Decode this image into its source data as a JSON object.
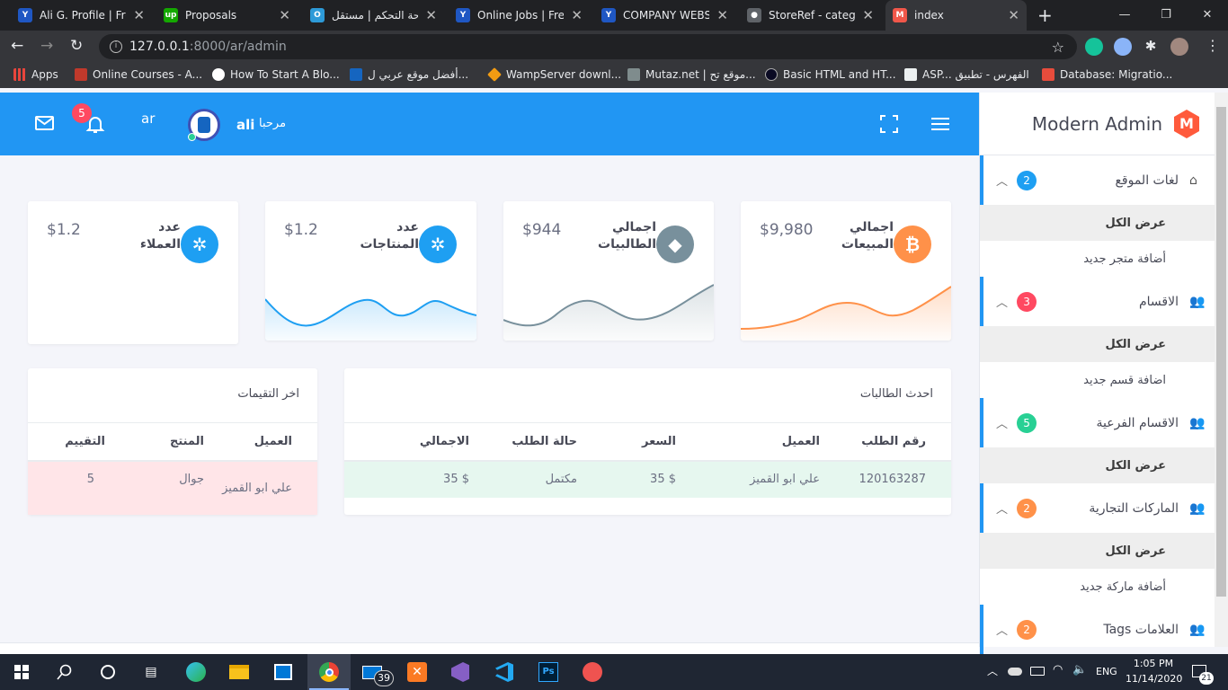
{
  "browser": {
    "tabs": [
      {
        "title": "Ali G. Profile | Free",
        "fav_color": "#1f57c3",
        "fav_char": "Y"
      },
      {
        "title": "Proposals",
        "fav_color": "#14a800",
        "fav_char": "up"
      },
      {
        "title": "لوحة التحكم | مستقل",
        "fav_color": "#2d9ad8",
        "fav_char": "O"
      },
      {
        "title": "Online Jobs | Freel",
        "fav_color": "#1f57c3",
        "fav_char": "Y"
      },
      {
        "title": "COMPANY WEBSIT",
        "fav_color": "#1f57c3",
        "fav_char": "Y"
      },
      {
        "title": "StoreRef - categor",
        "fav_color": "#5f6368",
        "fav_char": "●"
      },
      {
        "title": "index",
        "fav_color": "#f1574a",
        "fav_char": "M"
      }
    ],
    "url_host": "127.0.0.1",
    "url_rest": ":8000/ar/admin",
    "bookmarks": [
      {
        "label": "Apps",
        "color": "#e8453c"
      },
      {
        "label": "Online Courses - A...",
        "color": "#c0392b"
      },
      {
        "label": "How To Start A Blo...",
        "color": "#ffffff"
      },
      {
        "label": "أفضل موقع عربي ل...",
        "color": "#1565c0"
      },
      {
        "label": "WampServer downl...",
        "color": "#f39c12"
      },
      {
        "label": "Mutaz.net | موقع تح...",
        "color": "#7f8c8d"
      },
      {
        "label": "Basic HTML and HT...",
        "color": "#0a0a23"
      },
      {
        "label": "ASP... الفهرس - تطبيق",
        "color": "#ecf0f1"
      },
      {
        "label": "Database: Migratio...",
        "color": "#e74c3c"
      }
    ]
  },
  "header": {
    "notifications_count": "5",
    "lang": "ar",
    "greeting": "مرحبا",
    "username": "ali"
  },
  "sidebar": {
    "brand": "Modern Admin",
    "logo_letter": "M",
    "menus": [
      {
        "title": "لغات الموقع",
        "badge": "2",
        "badge_color": "#1e9ff2",
        "icon": "home-icon",
        "subs": [
          "عرض الكل",
          "أضافة متجر جديد"
        ]
      },
      {
        "title": "الاقسام",
        "badge": "3",
        "badge_color": "#ff4961",
        "icon": "users-icon",
        "subs": [
          "عرض الكل",
          "اضافة قسم جديد"
        ]
      },
      {
        "title": "الاقسام الفرعية",
        "badge": "5",
        "badge_color": "#28d094",
        "icon": "users-icon",
        "subs": [
          "عرض الكل"
        ]
      },
      {
        "title": "الماركات التجارية",
        "badge": "2",
        "badge_color": "#ff9149",
        "icon": "users-icon",
        "subs": [
          "عرض الكل",
          "أضافة ماركة جديد"
        ]
      },
      {
        "title": "Tags العلامات",
        "badge": "2",
        "badge_color": "#ff9149",
        "icon": "users-icon",
        "subs": []
      }
    ]
  },
  "stats": [
    {
      "label1": "اجمالي",
      "label2": "المبيعات",
      "value": "$9,980",
      "icon": "bitcoin-icon",
      "color": "#ff9149",
      "glyph": "₿"
    },
    {
      "label1": "اجمالي",
      "label2": "الطالبيات",
      "value": "$944",
      "icon": "ethereum-icon",
      "color": "#78909c",
      "glyph": "◆"
    },
    {
      "label1": "عدد",
      "label2": "المنتاجات",
      "value": "$1.2",
      "icon": "ripple-icon",
      "color": "#1e9ff2",
      "glyph": "✲"
    },
    {
      "label1": "عدد",
      "label2": "العملاء",
      "value": "$1.2",
      "icon": "ripple-icon",
      "color": "#1e9ff2",
      "glyph": "✲"
    }
  ],
  "orders": {
    "title": "احدث الطالبات",
    "columns": [
      "رقم الطلب",
      "العميل",
      "السعر",
      "حالة الطلب",
      "الاجمالي"
    ],
    "rows": [
      [
        "120163287",
        "علي ابو القميز",
        "$ 35",
        "مكتمل",
        "$ 35"
      ]
    ]
  },
  "ratings": {
    "title": "اخر التقيمات",
    "columns": [
      "العميل",
      "المنتج",
      "التقييم"
    ],
    "rows": [
      [
        "علي ابو القميز",
        "جوال",
        "5"
      ]
    ]
  },
  "taskbar": {
    "time": "1:05 PM",
    "date": "11/14/2020",
    "lang": "ENG",
    "mail_badge": "39",
    "notif_badge": "21"
  }
}
